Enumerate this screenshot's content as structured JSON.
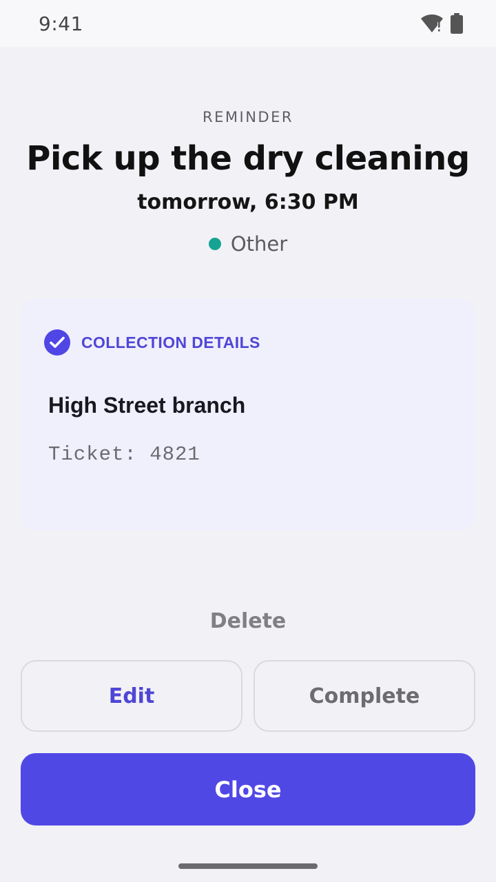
{
  "status_bar": {
    "time": "9:41",
    "icons": [
      "wifi-alert-icon",
      "battery-icon"
    ]
  },
  "reminder": {
    "eyebrow": "REMINDER",
    "title": "Pick up the dry cleaning",
    "when": "tomorrow, 6:30 PM",
    "category": {
      "label": "Other",
      "color": "#16a394"
    }
  },
  "details": {
    "heading": "COLLECTION DETAILS",
    "icon": "check-circle-icon",
    "branch": "High Street branch",
    "ticket": "Ticket: 4821"
  },
  "actions": {
    "delete_label": "Delete",
    "edit_label": "Edit",
    "complete_label": "Complete",
    "close_label": "Close"
  },
  "colors": {
    "accent": "#5048e5",
    "accent_text": "#4f46d6",
    "card_bg": "#f0effc",
    "page_bg": "#f2f2f6"
  }
}
